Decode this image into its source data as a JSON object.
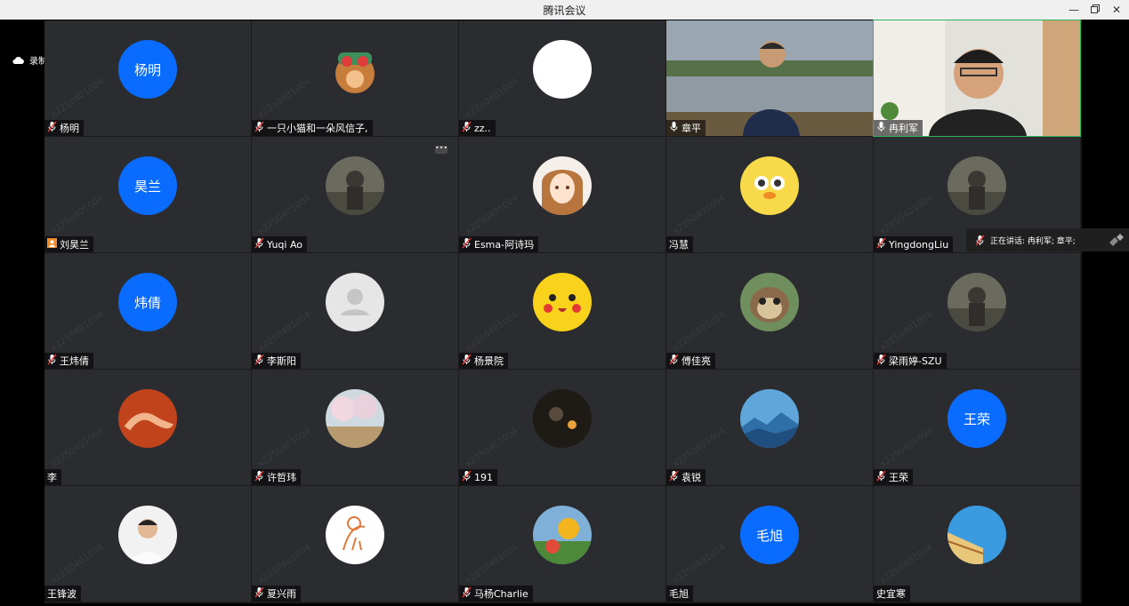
{
  "window": {
    "title": "腾讯会议",
    "minimize_icon": "minimize-icon",
    "restore_icon": "restore-icon",
    "close_icon": "close-icon"
  },
  "recording": {
    "label": "录制中",
    "icon": "cloud-icon"
  },
  "speaking": {
    "label": "正在讲话: 冉利军; 章平;"
  },
  "colors": {
    "avatar_blue": "#0a6cff",
    "tile_bg": "#2b2c2f",
    "active_border": "#2db35a",
    "muted_mic": "#e53935"
  },
  "participants": [
    {
      "name": "杨明",
      "avatar_text": "杨明",
      "mic": "muted"
    },
    {
      "name": "一只小猫和一朵风信子,",
      "avatar": "cartoon-avatar",
      "mic": "muted"
    },
    {
      "name": "zz..",
      "avatar": "blank-avatar",
      "mic": "muted"
    },
    {
      "name": "章平",
      "video": true,
      "mic": "on"
    },
    {
      "name": "冉利军",
      "video": true,
      "mic": "on",
      "active": true
    },
    {
      "name": "刘昊兰",
      "avatar_text": "昊兰",
      "mic": "none",
      "badge": "person-icon"
    },
    {
      "name": "Yuqi Ao",
      "avatar": "photo-avatar",
      "mic": "muted",
      "more": true
    },
    {
      "name": "Esma-阿诗玛",
      "avatar": "anime-avatar",
      "mic": "muted"
    },
    {
      "name": "冯慧",
      "avatar": "duck-avatar",
      "mic": "none"
    },
    {
      "name": "YingdongLiu",
      "avatar": "photo-avatar",
      "mic": "muted"
    },
    {
      "name": "王炜倩",
      "avatar_text": "炜倩",
      "mic": "muted"
    },
    {
      "name": "李斯阳",
      "avatar": "default-avatar",
      "mic": "muted"
    },
    {
      "name": "杨景院",
      "avatar": "pikachu-avatar",
      "mic": "muted"
    },
    {
      "name": "傅佳亮",
      "avatar": "sloth-avatar",
      "mic": "muted"
    },
    {
      "name": "梁雨婷-SZU",
      "avatar": "photo-avatar",
      "mic": "muted"
    },
    {
      "name": "李",
      "avatar": "hands-avatar",
      "mic": "none"
    },
    {
      "name": "许哲玮",
      "avatar": "landscape-avatar",
      "mic": "muted"
    },
    {
      "name": "191",
      "avatar": "night-avatar",
      "mic": "muted"
    },
    {
      "name": "袁锐",
      "avatar": "mountain-avatar",
      "mic": "muted"
    },
    {
      "name": "王荣",
      "avatar_text": "王荣",
      "mic": "muted"
    },
    {
      "name": "王锋波",
      "avatar": "portrait-avatar",
      "mic": "none"
    },
    {
      "name": "夏兴雨",
      "avatar": "drawing-avatar",
      "mic": "muted"
    },
    {
      "name": "马杨Charlie",
      "avatar": "colorful-avatar",
      "mic": "muted"
    },
    {
      "name": "毛旭",
      "avatar_text": "毛旭",
      "mic": "none"
    },
    {
      "name": "史宜寒",
      "avatar": "building-avatar",
      "mic": "none"
    }
  ]
}
